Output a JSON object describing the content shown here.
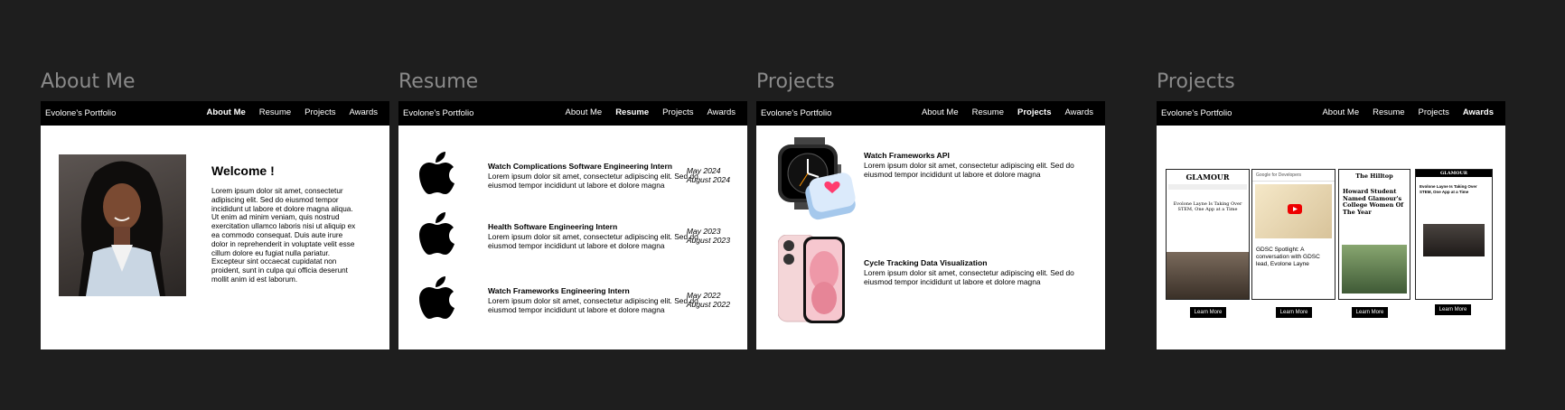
{
  "nav": {
    "brand": "Evolone's Portfolio",
    "links": [
      "About Me",
      "Resume",
      "Projects",
      "Awards"
    ]
  },
  "frames": [
    {
      "label": "About Me",
      "active": "About Me"
    },
    {
      "label": "Resume",
      "active": "Resume"
    },
    {
      "label": "Projects",
      "active": "Projects"
    },
    {
      "label": "Projects",
      "active": "Awards"
    }
  ],
  "about": {
    "heading": "Welcome !",
    "body": "Lorem ipsum dolor sit amet, consectetur adipiscing elit. Sed do eiusmod tempor incididunt ut labore et dolore magna aliqua. Ut enim ad minim veniam, quis nostrud exercitation ullamco laboris nisi ut aliquip ex ea commodo consequat. Duis aute irure dolor in reprehenderit in voluptate velit esse cillum dolore eu fugiat nulla pariatur. Excepteur sint occaecat cupidatat non proident, sunt in culpa qui officia deserunt mollit anim id est laborum."
  },
  "resume": {
    "jobs": [
      {
        "title": "Watch Complications Software Engineering Intern",
        "desc": "Lorem ipsum dolor sit amet, consectetur adipiscing elit. Sed do eiusmod tempor incididunt ut labore et dolore magna",
        "start": "May 2024",
        "end": "August 2024"
      },
      {
        "title": "Health Software Engineering Intern",
        "desc": "Lorem ipsum dolor sit amet, consectetur adipiscing elit. Sed do eiusmod tempor incididunt ut labore et dolore magna",
        "start": "May 2023",
        "end": "August 2023"
      },
      {
        "title": "Watch Frameworks Engineering Intern",
        "desc": "Lorem ipsum dolor sit amet, consectetur adipiscing elit. Sed do eiusmod tempor incididunt ut labore et dolore magna",
        "start": "May 2022",
        "end": "August 2022"
      }
    ]
  },
  "projects": {
    "items": [
      {
        "title": "Watch Frameworks API",
        "desc": "Lorem ipsum dolor sit amet, consectetur adipiscing elit. Sed do eiusmod tempor incididunt ut labore et dolore magna"
      },
      {
        "title": "Cycle Tracking Data Visualization",
        "desc": "Lorem ipsum dolor sit amet, consectetur adipiscing elit. Sed do eiusmod tempor incididunt ut labore et dolore magna"
      }
    ]
  },
  "awards": {
    "cards": [
      {
        "source": "GLAMOUR",
        "headline": "Evolone Layne Is Taking Over STEM, One App at a Time"
      },
      {
        "source": "Google for Developers",
        "headline": "GDSC Spotlight: A conversation with GDSC lead, Evolone Layne"
      },
      {
        "source": "The Hilltop",
        "headline": "Howard Student Named Glamour's College Women Of The Year"
      },
      {
        "source": "GLAMOUR",
        "headline": "Evolone Layne Is Taking Over STEM, One App at a Time"
      }
    ],
    "button_label": "Learn More"
  }
}
